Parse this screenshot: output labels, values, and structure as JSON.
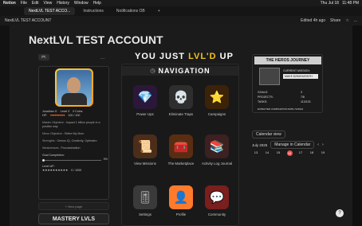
{
  "menu": {
    "app": "Notion",
    "items": [
      "File",
      "Edit",
      "View",
      "History",
      "Window",
      "Help"
    ],
    "right": [
      "Thu Jul 18",
      "11:48 PM"
    ]
  },
  "tabs": [
    {
      "label": "NextLVL TEST ACCO..."
    },
    {
      "label": "Instructions"
    },
    {
      "label": "Notifications OB"
    }
  ],
  "topbar": {
    "left": "NextLVL TEST ACCOUNT",
    "edited": "Edited 4h ago",
    "share": "Share",
    "star": "☆",
    "more": "..."
  },
  "page": {
    "title": "NextLVL TEST ACCOUNT"
  },
  "profile": {
    "name": "Jonathan G",
    "level": "Level 3",
    "coins": "0 Coins",
    "hp_label": "HP:",
    "hp_hearts": "♥♥♥♥♥♥♥♥♥♥",
    "hp_value": "100 / 100",
    "master": "Master Objective",
    "master_value": ": Impact 1 billion people in a positive way",
    "minor": "Minor Objective",
    "minor_value": ": Retire My Mom",
    "strengths": "Strengths",
    "strengths_value": ": Genius IQ, Creativity, Optimism",
    "weakness": "Weaknesses",
    "weakness_value": ": Procrastination",
    "goal": "Goal Completion:",
    "goal_value": "0%",
    "levelup": "Level UP:",
    "stars": "★★★★★★★★★★",
    "xp": "0 / 1000"
  },
  "newpage": "+ New page",
  "mastery": "MASTERY LVLS",
  "headline": {
    "a": "YOU JUST",
    "b": "LVL'D",
    "c": "UP"
  },
  "nav": {
    "title": "NAVIGATION",
    "items": [
      {
        "label": "Power Ups"
      },
      {
        "label": "Eliminate Traps"
      },
      {
        "label": "Campaigns"
      },
      {
        "label": "View Missions"
      },
      {
        "label": "The Marketplace"
      },
      {
        "label": "Activity Log Journal"
      },
      {
        "label": "Settings"
      },
      {
        "label": "Profile"
      },
      {
        "label": "Community"
      }
    ]
  },
  "heroes": {
    "title": "THE HEROS JOURNEY",
    "mission": "CURRENT MISSION:",
    "mission_value": "MAKE $250K/MONTH",
    "goals": "GOALS:",
    "goals_value": "3",
    "projects": "PROJECTS:",
    "projects_value": "7/8",
    "tasks": "TASKS:",
    "tasks_value": "113/133",
    "expected": "EXPECTED COMPLETION RATE 72/2024"
  },
  "calendar": {
    "view": "Calendar view",
    "month": "July 2025",
    "manage": "Manage in Calendar",
    "days": [
      "13",
      "14",
      "15",
      "16",
      "17",
      "18",
      "19"
    ]
  },
  "help": "?"
}
